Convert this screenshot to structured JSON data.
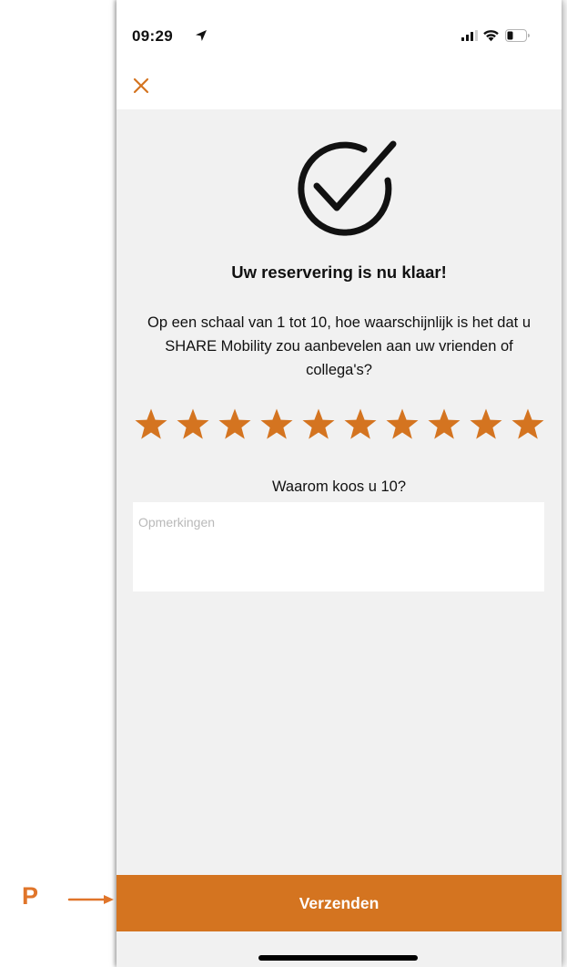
{
  "status_bar": {
    "time": "09:29"
  },
  "confirmation": {
    "title": "Uw reservering is nu klaar!",
    "question": "Op een schaal van 1 tot 10, hoe waarschijnlijk is het dat u SHARE Mobility zou aanbevelen aan uw vrienden of collega's?",
    "rating": 10,
    "rating_max": 10,
    "reason_prompt": "Waarom koos u 10?",
    "comments_placeholder": "Opmerkingen",
    "submit_label": "Verzenden"
  },
  "annotation": {
    "letter": "P"
  },
  "colors": {
    "accent": "#d47420",
    "background": "#f1f1f1",
    "annotation": "#e0752a"
  },
  "icons": {
    "close": "close-icon",
    "checkmark": "checkmark-circle-icon",
    "star": "star-icon"
  }
}
